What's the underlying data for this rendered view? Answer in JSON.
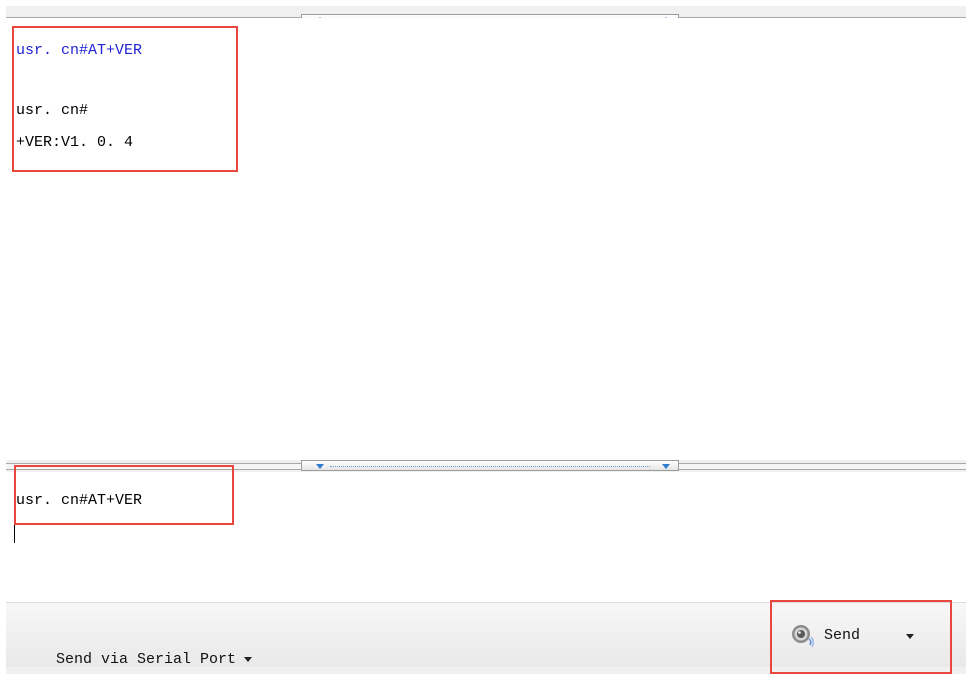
{
  "output": {
    "lines": [
      {
        "text": "usr. cn#AT+VER",
        "kind": "echo"
      },
      {
        "text": "usr. cn#",
        "kind": "response"
      },
      {
        "text": "+VER:V1. 0. 4",
        "kind": "response"
      }
    ]
  },
  "input": {
    "value": "usr. cn#AT+VER"
  },
  "toolbar": {
    "serial_label": "Send via Serial Port",
    "send_label": "Send"
  },
  "icons": {
    "splitter_top": "up-arrow-icon",
    "splitter_bottom": "down-arrow-icon",
    "send": "speaker-icon",
    "dropdown": "chevron-down-icon"
  },
  "colors": {
    "echo_text": "#2323d6",
    "highlight": "#e8463f",
    "splitter_arrow": "#2f7bd1"
  }
}
